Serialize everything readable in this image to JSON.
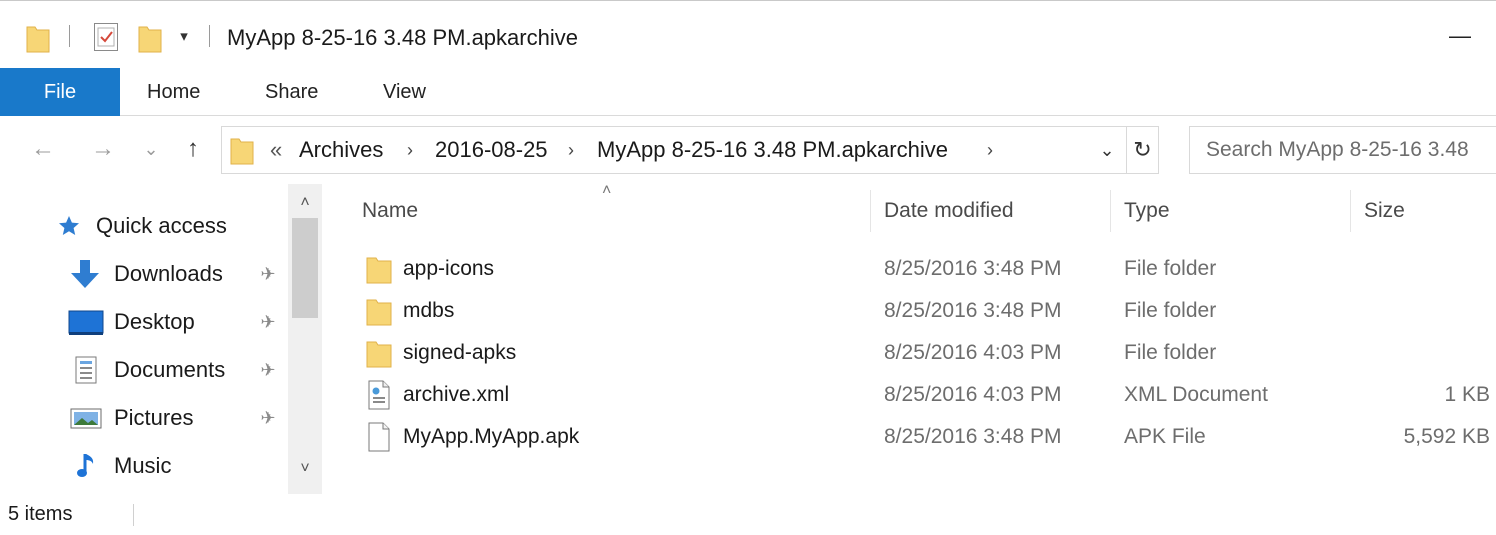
{
  "window": {
    "title": "MyApp 8-25-16 3.48 PM.apkarchive",
    "minimize_glyph": "—"
  },
  "quick_access_toolbar": {
    "icons": [
      "folder-icon",
      "properties-icon",
      "new-folder-icon"
    ],
    "dropdown_glyph": "▾"
  },
  "ribbon": {
    "tabs": [
      "File",
      "Home",
      "Share",
      "View"
    ]
  },
  "navigation": {
    "back_glyph": "←",
    "forward_glyph": "→",
    "recent_glyph": "⌄",
    "up_glyph": "↑",
    "overflow_glyph": "«",
    "breadcrumb": [
      "Archives",
      "2016-08-25",
      "MyApp 8-25-16 3.48 PM.apkarchive"
    ],
    "separator_glyph": "›",
    "dropdown_glyph": "⌄",
    "refresh_glyph": "↻",
    "search_placeholder": "Search MyApp 8-25-16 3.48"
  },
  "nav_pane": {
    "items": [
      {
        "label": "Quick access",
        "icon": "star-icon",
        "pinned": false
      },
      {
        "label": "Downloads",
        "icon": "download-icon",
        "pinned": true
      },
      {
        "label": "Desktop",
        "icon": "desktop-icon",
        "pinned": true
      },
      {
        "label": "Documents",
        "icon": "documents-icon",
        "pinned": true
      },
      {
        "label": "Pictures",
        "icon": "pictures-icon",
        "pinned": true
      },
      {
        "label": "Music",
        "icon": "music-icon",
        "pinned": false
      }
    ],
    "pin_glyph": "✈",
    "scroll_up_glyph": "˄",
    "scroll_down_glyph": "˅"
  },
  "file_list": {
    "sort_glyph": "˄",
    "columns": {
      "name": "Name",
      "date": "Date modified",
      "type": "Type",
      "size": "Size"
    },
    "rows": [
      {
        "name": "app-icons",
        "date": "8/25/2016 3:48 PM",
        "type": "File folder",
        "size": "",
        "icon": "folder-icon"
      },
      {
        "name": "mdbs",
        "date": "8/25/2016 3:48 PM",
        "type": "File folder",
        "size": "",
        "icon": "folder-icon"
      },
      {
        "name": "signed-apks",
        "date": "8/25/2016 4:03 PM",
        "type": "File folder",
        "size": "",
        "icon": "folder-icon"
      },
      {
        "name": "archive.xml",
        "date": "8/25/2016 4:03 PM",
        "type": "XML Document",
        "size": "1 KB",
        "icon": "xml-file-icon"
      },
      {
        "name": "MyApp.MyApp.apk",
        "date": "8/25/2016 3:48 PM",
        "type": "APK File",
        "size": "5,592 KB",
        "icon": "file-icon"
      }
    ]
  },
  "status": {
    "item_count": "5 items"
  },
  "colors": {
    "file_tab": "#1979ca",
    "folder": "#f7d676",
    "folder_dark": "#e8b84a",
    "accent_blue": "#1e73d6"
  }
}
